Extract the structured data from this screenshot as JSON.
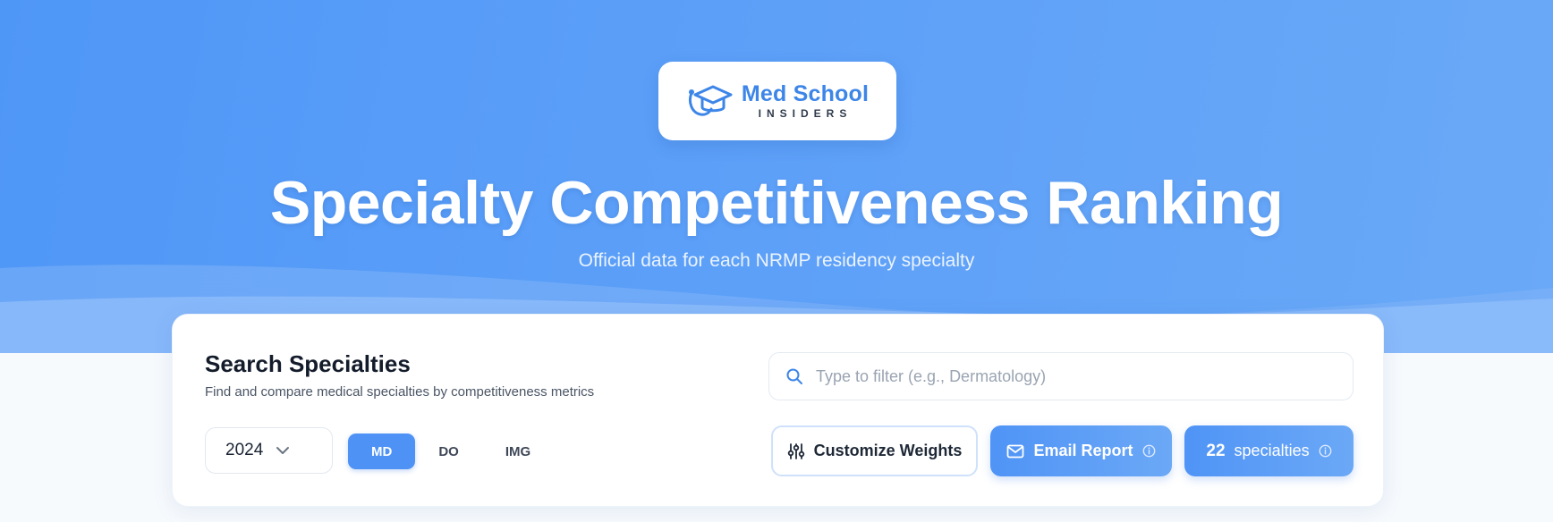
{
  "brand": {
    "name_main": "Med School",
    "name_sub": "INSIDERS",
    "icon": "graduation-cap-stethoscope-icon",
    "color": "#3d86e8"
  },
  "hero": {
    "title": "Specialty Competitiveness Ranking",
    "subtitle": "Official data for each NRMP residency specialty",
    "background_color": "#5a9ef7"
  },
  "search_card": {
    "title": "Search Specialties",
    "description": "Find and compare medical specialties by competitiveness metrics",
    "search": {
      "placeholder": "Type to filter (e.g., Dermatology)",
      "value": "",
      "icon": "search-icon"
    },
    "year_select": {
      "value": "2024",
      "icon": "chevron-down-icon"
    },
    "applicant_types": [
      {
        "label": "MD",
        "active": true
      },
      {
        "label": "DO",
        "active": false
      },
      {
        "label": "IMG",
        "active": false
      }
    ],
    "buttons": {
      "customize_weights": {
        "label": "Customize Weights",
        "icon": "sliders-icon"
      },
      "email_report": {
        "label": "Email Report",
        "icon": "mail-icon",
        "info_icon": "info-icon"
      },
      "count": {
        "number": "22",
        "label": "specialties",
        "info_icon": "info-icon"
      }
    },
    "accent_color": "#4e92f5"
  }
}
